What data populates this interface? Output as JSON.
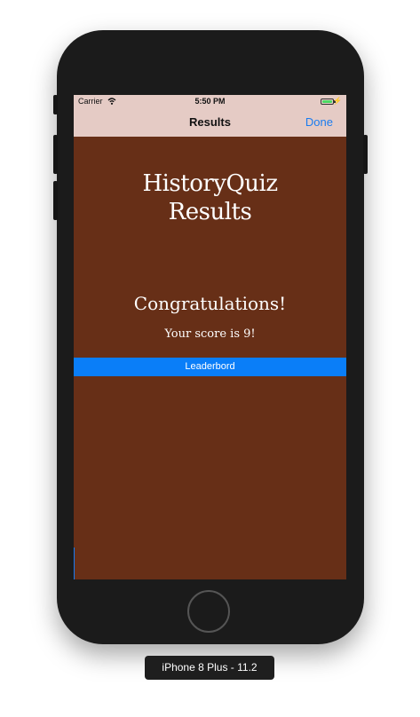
{
  "status_bar": {
    "carrier": "Carrier",
    "time": "5:50 PM"
  },
  "nav": {
    "title": "Results",
    "done_label": "Done"
  },
  "main": {
    "quiz_title_line1": "HistoryQuiz",
    "quiz_title_line2": "Results",
    "congratulations": "Congratulations!",
    "score_text": "Your score is 9!",
    "leaderboard_label": "Leaderbord"
  },
  "simulator": {
    "device_label": "iPhone 8 Plus - 11.2"
  },
  "colors": {
    "background": "#672f17",
    "nav_bar": "#e5cbc5",
    "accent_blue": "#0a7ef8"
  }
}
